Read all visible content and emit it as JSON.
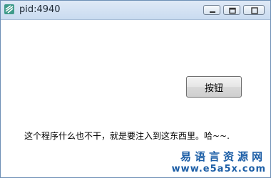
{
  "window": {
    "title": "pid:4940",
    "app_icon": "app-icon",
    "controls": {
      "minimize": "minimize-icon",
      "maximize": "maximize-icon",
      "close": "close-icon"
    }
  },
  "main": {
    "button_label": "按钮",
    "message": "这个程序什么也不干，就是要注入到这东西里。哈~~."
  },
  "watermark": {
    "name": "易语言资源网",
    "url": "www.e5a5x.com"
  },
  "colors": {
    "titlebar": "#c9dbf0",
    "watermark": "#1c5ea6"
  }
}
